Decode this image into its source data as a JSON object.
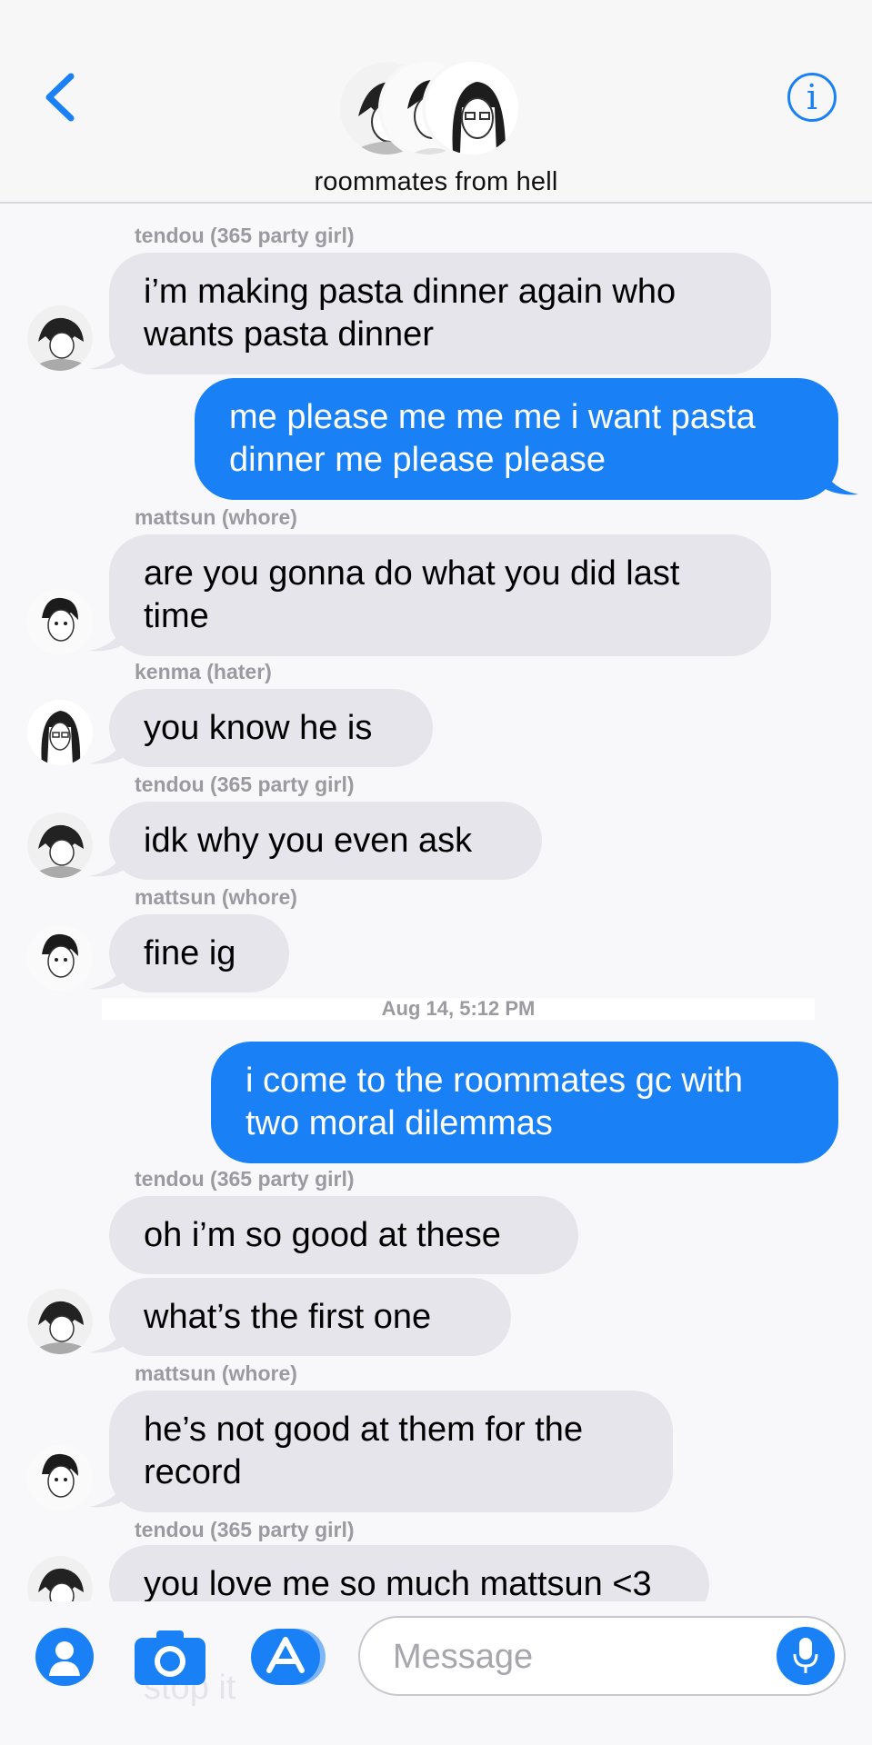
{
  "header": {
    "title": "roommates from hell",
    "info_icon_glyph": "i",
    "accent_color": "#1a80f5"
  },
  "messages": [
    {
      "sender": "tendou (365 party girl)",
      "text": "i’m making pasta dinner again who wants pasta dinner",
      "direction": "incoming"
    },
    {
      "text": "me please me me me i want pasta dinner me please please",
      "direction": "outgoing"
    },
    {
      "sender": "mattsun (whore)",
      "text": "are you gonna do what you did last time",
      "direction": "incoming"
    },
    {
      "sender": "kenma (hater)",
      "text": "you know he is",
      "direction": "incoming"
    },
    {
      "sender": "tendou (365 party girl)",
      "text": "idk why you even ask",
      "direction": "incoming"
    },
    {
      "sender": "mattsun (whore)",
      "text": "fine ig",
      "direction": "incoming"
    },
    {
      "timestamp": "Aug 14, 5:12 PM"
    },
    {
      "text": "i come to the roommates gc with two moral dilemmas",
      "direction": "outgoing"
    },
    {
      "sender": "tendou (365 party girl)",
      "text": "oh i’m so good at these",
      "direction": "incoming"
    },
    {
      "text": "what’s the first one",
      "direction": "incoming"
    },
    {
      "sender": "mattsun (whore)",
      "text": "he’s not good at them for the record",
      "direction": "incoming"
    },
    {
      "sender": "tendou (365 party girl)",
      "text": "you love me so much mattsun <3",
      "direction": "incoming"
    },
    {
      "text": "stop it",
      "direction": "incoming",
      "note_visible": "faded under composer"
    }
  ],
  "composer": {
    "placeholder": "Message",
    "value": ""
  },
  "colors": {
    "incoming_bubble": "#e6e5eb",
    "outgoing_bubble": "#1a80f5",
    "background": "#f8f8fa"
  },
  "icons": [
    "chevron-left-icon",
    "info-icon",
    "contact-icon",
    "camera-icon",
    "app-store-icon",
    "microphone-icon"
  ]
}
